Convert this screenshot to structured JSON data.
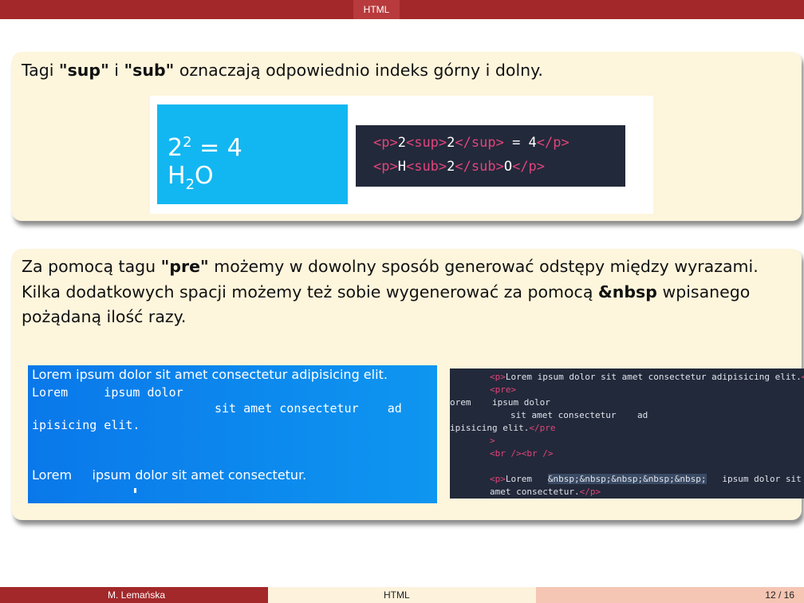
{
  "header": {
    "title": "HTML"
  },
  "block1": {
    "text_before_sup": "Tagi ",
    "sup": "\"sup\"",
    "mid": " i ",
    "sub": "\"sub\"",
    "text_after": " oznaczają odpowiednio indeks górny i dolny.",
    "preview": {
      "line1_base": "2",
      "line1_sup": "2",
      "line1_rest": " = 4",
      "line2_base": "H",
      "line2_sub": "2",
      "line2_rest": "O"
    },
    "code": {
      "l1_open": "<p>",
      "l1_a": "2",
      "l1_supopen": "<sup>",
      "l1_b": "2",
      "l1_supclose": "</sup>",
      "l1_c": " = 4",
      "l1_close": "</p>",
      "l2_open": "<p>",
      "l2_a": "H",
      "l2_subopen": "<sub>",
      "l2_b": "2",
      "l2_subclose": "</sub>",
      "l2_c": "O",
      "l2_close": "</p>"
    }
  },
  "block2": {
    "l1_a": "Za pomocą tagu ",
    "l1_b": "\"pre\"",
    "l1_c": " możemy w dowolny sposób generować odstępy między wyrazami.",
    "l2": "Kilka dodatkowych spacji możemy też sobie wygenerować za pomocą ",
    "l2_b": "&nbsp",
    "l2_c": " wpisanego",
    "l3": "pożądaną ilość razy.",
    "preview": {
      "p1": "Lorem ipsum dolor sit amet consectetur adipisicing elit.",
      "pre1": "Lorem     ipsum dolor",
      "pre2": "sit amet consectetur    ad",
      "pre3": "ipisicing elit.",
      "p2": "Lorem     ipsum dolor sit amet consectetur."
    },
    "code": {
      "r1_tag": "<p>",
      "r1_txt": "Lorem ipsum dolor sit amet consectetur adipisicing elit.",
      "r1_end": "</",
      "r2_tag": "<pre>",
      "r3": "orem    ipsum dolor",
      "r4": "sit amet consectetur    ad",
      "r5_txt": "ipisicing elit.",
      "r5_tag": "</pre",
      "r6": ">",
      "r7": "<br /><br />",
      "r8_tag": "<p>",
      "r8_txt": "Lorem   ",
      "r8_hl": "&nbsp;&nbsp;&nbsp;&nbsp;&nbsp;",
      "r8_rest": "   ipsum dolor sit",
      "r9_txt": "amet consectetur.",
      "r9_tag": "</p>"
    }
  },
  "footer": {
    "author": "M. Lemańska",
    "title": "HTML",
    "page": "12 / 16"
  }
}
